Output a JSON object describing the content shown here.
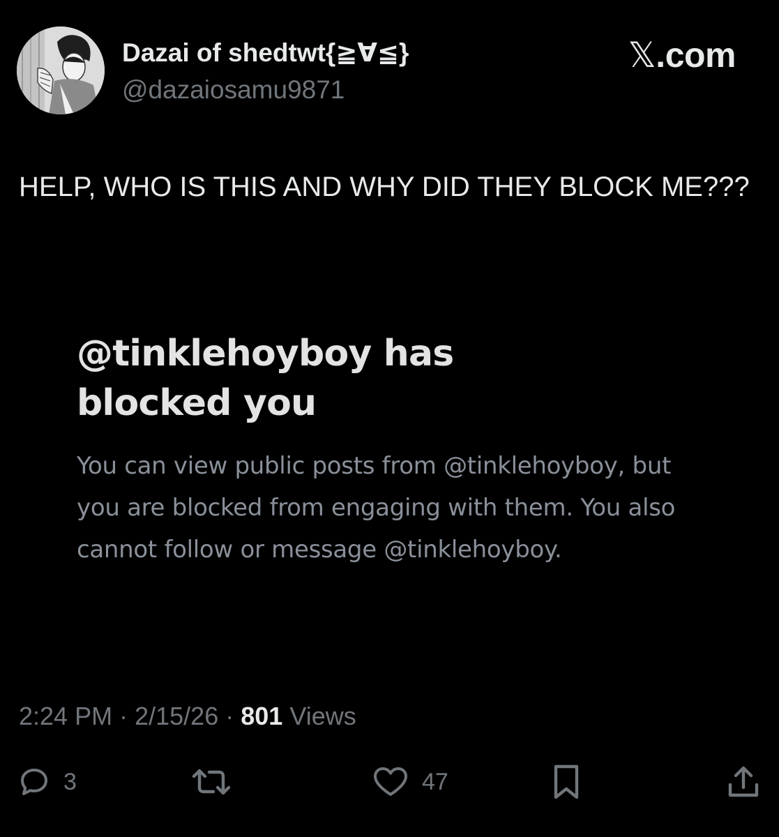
{
  "author": {
    "display_name": "Dazai of shedtwt{≧∀≦}",
    "handle": "@dazaiosamu9871"
  },
  "brand": {
    "glyph": "𝕏",
    "suffix": ".com"
  },
  "post": {
    "text": "HELP, WHO IS THIS AND WHY DID THEY BLOCK ME???"
  },
  "embedded_screenshot": {
    "title": "@tinklehoyboy has blocked you",
    "body": "You can view public posts from @tinklehoyboy, but you are blocked from engaging with them. You also cannot follow or message @tinklehoyboy."
  },
  "meta": {
    "time": "2:24 PM",
    "separator": "·",
    "date": "2/15/26",
    "views_count": "801",
    "views_label": "Views"
  },
  "actions": {
    "reply_count": "3",
    "like_count": "47"
  },
  "icons": {
    "reply": "reply-icon",
    "repost": "repost-icon",
    "like": "heart-icon",
    "bookmark": "bookmark-icon",
    "share": "share-icon"
  },
  "colors": {
    "background": "#000000",
    "primary_text": "#e7e9ea",
    "secondary_text": "#71767b"
  }
}
